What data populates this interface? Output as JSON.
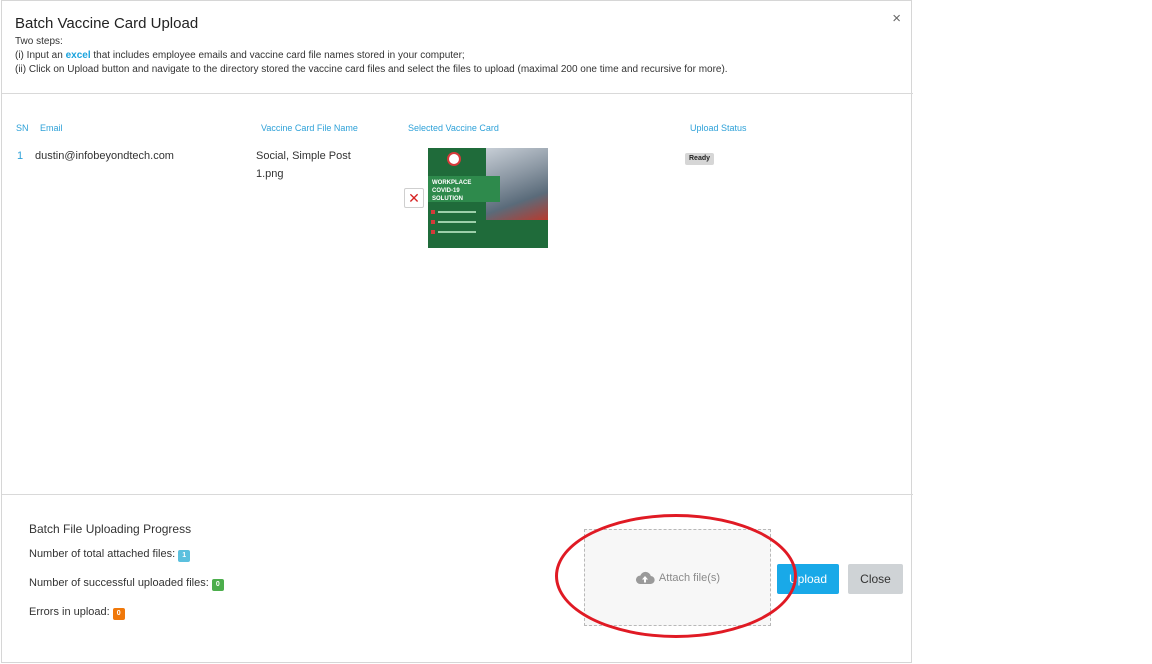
{
  "modal": {
    "title": "Batch Vaccine Card Upload",
    "close_glyph": "×"
  },
  "instructions": {
    "intro": "Two steps:",
    "step1_pre": "(i) Input an ",
    "step1_link": "excel",
    "step1_post": " that includes employee emails and vaccine card file names stored in your computer;",
    "step2": "(ii) Click on Upload button and navigate to the directory stored the vaccine card files and select the files to upload (maximal 200 one time and recursive for more)."
  },
  "table": {
    "headers": {
      "sn": "SN",
      "email": "Email",
      "file_name": "Vaccine Card File Name",
      "selected_card": "Selected Vaccine Card",
      "status": "Upload Status"
    },
    "rows": [
      {
        "sn": "1",
        "email": "dustin@infobeyondtech.com",
        "file_name_line1": "Social, Simple Post",
        "file_name_line2": "1.png",
        "status": "Ready"
      }
    ]
  },
  "thumbnail": {
    "banner_line1": "WORKPLACE",
    "banner_line2": "COVID-19",
    "banner_line3": "SOLUTION"
  },
  "progress": {
    "title": "Batch File Uploading Progress",
    "total_label": "Number of total attached files:",
    "total_value": "1",
    "success_label": "Number of successful uploaded files:",
    "success_value": "0",
    "errors_label": "Errors in upload:",
    "errors_value": "0"
  },
  "attach": {
    "label": "Attach file(s)",
    "icon": "cloud-upload-icon"
  },
  "buttons": {
    "upload": "Upload",
    "close": "Close"
  },
  "colors": {
    "accent": "#19a9e8",
    "annotation": "#e01a24"
  }
}
